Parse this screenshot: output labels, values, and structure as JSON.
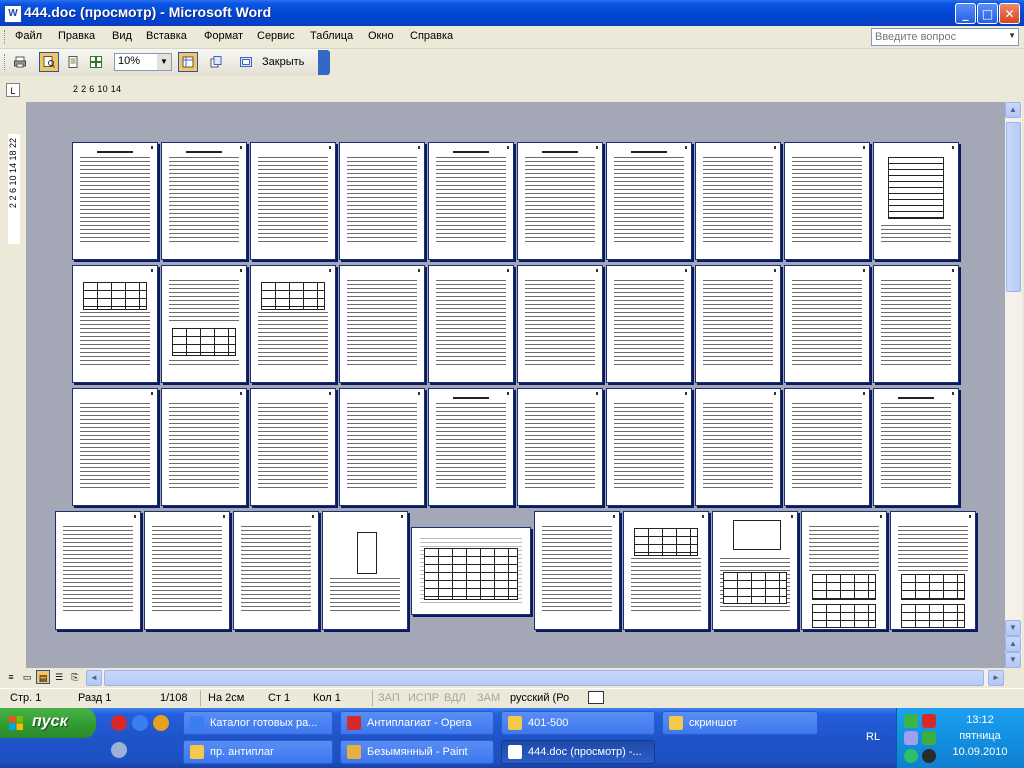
{
  "window": {
    "title": "444.doc (просмотр) - Microsoft Word",
    "app_icon_letter": "W",
    "controls": {
      "minimize": "_",
      "maximize": "□",
      "close": "✕"
    }
  },
  "menu": {
    "items": [
      "Файл",
      "Правка",
      "Вид",
      "Вставка",
      "Формат",
      "Сервис",
      "Таблица",
      "Окно",
      "Справка"
    ],
    "help_placeholder": "Введите вопрос"
  },
  "toolbar": {
    "icons": [
      "print-icon",
      "magnifier-icon",
      "one-page-icon",
      "multiple-pages-icon",
      "shrink-to-fit-icon",
      "full-screen-icon"
    ],
    "zoom_value": "10%",
    "close_label": "Закрыть"
  },
  "ruler": {
    "horizontal_label": "2  2  6  10  14",
    "vertical_label": "2  2  6  10  14  18  22"
  },
  "preview": {
    "page_count_visible": 40,
    "rows": 4,
    "columns": 10
  },
  "status": {
    "page": "Стр. 1",
    "section": "Разд 1",
    "of_total": "1/108",
    "at": "На 2см",
    "line": "Ст 1",
    "column": "Кол 1",
    "rec": "ЗАП",
    "trk": "ИСПР",
    "ext": "ВДЛ",
    "ovr": "ЗАМ",
    "language": "русский (Ро"
  },
  "taskbar": {
    "start_label": "пуск",
    "tasks_row1": [
      {
        "label": "Каталог готовых ра...",
        "icon": "ie-icon",
        "color": "#3a7ff2"
      },
      {
        "label": "Антиплагиат - Opera",
        "icon": "opera-icon",
        "color": "#d62a2a"
      },
      {
        "label": "401-500",
        "icon": "folder-icon",
        "color": "#f3c94a"
      },
      {
        "label": "скриншот",
        "icon": "folder-icon",
        "color": "#f3c94a"
      }
    ],
    "tasks_row2": [
      {
        "label": "пр. антиплаг",
        "icon": "folder-icon",
        "color": "#f3c94a"
      },
      {
        "label": "Безымянный - Paint",
        "icon": "paint-icon",
        "color": "#e8b040"
      },
      {
        "label": "444.doc (просмотр) -...",
        "icon": "word-icon",
        "color": "#ffffff"
      }
    ],
    "language_indicator": "RL",
    "clock_time": "13:12",
    "clock_day": "пятница",
    "clock_date": "10.09.2010"
  },
  "colors": {
    "title_bar": "#0145d0",
    "workspace": "#a4a7b5",
    "taskbar": "#245edb",
    "start_button": "#2f9a2f"
  }
}
